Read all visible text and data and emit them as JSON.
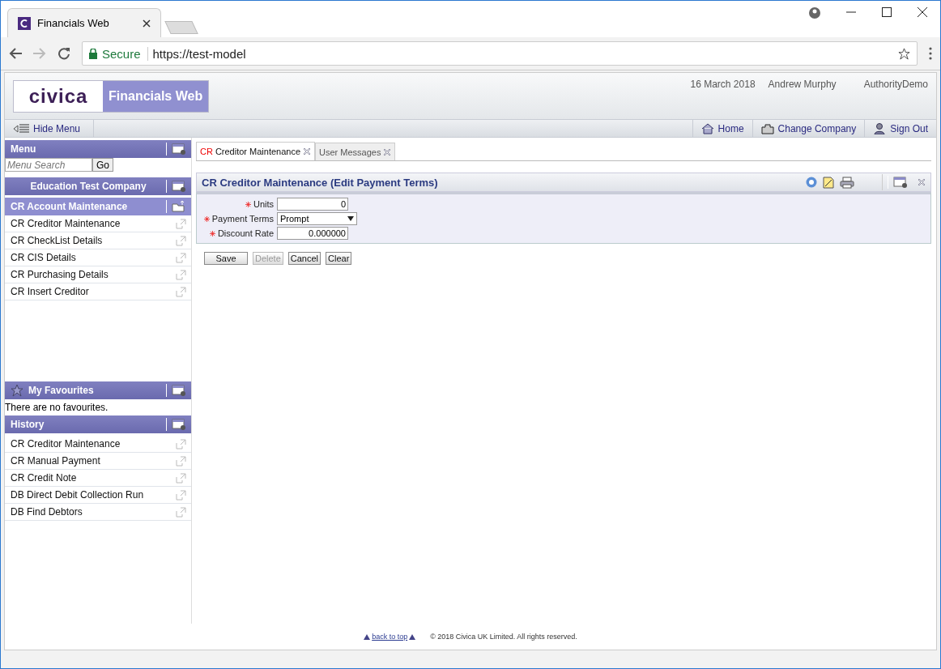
{
  "browser": {
    "tab_title": "Financials Web",
    "secure_label": "Secure",
    "url": "https://test-model"
  },
  "header": {
    "logo_text": "civica",
    "product": "Financials Web",
    "date": "16 March 2018",
    "user": "Andrew Murphy",
    "authority": "AuthorityDemo"
  },
  "navbar": {
    "hide_menu": "Hide Menu",
    "links": [
      {
        "kind": "home",
        "label": "Home"
      },
      {
        "kind": "company",
        "label": "Change Company"
      },
      {
        "kind": "signout",
        "label": "Sign Out"
      }
    ]
  },
  "sidebar": {
    "menu_title": "Menu",
    "search_placeholder": "Menu Search",
    "go": "Go",
    "company": "Education Test Company",
    "group": "CR Account Maintenance",
    "items": [
      "CR Creditor Maintenance",
      "CR CheckList Details",
      "CR CIS Details",
      "CR Purchasing Details",
      "CR Insert Creditor"
    ],
    "favourites_title": "My Favourites",
    "favourites_empty": "There are no favourites.",
    "history_title": "History",
    "history": [
      "CR Creditor Maintenance",
      "CR Manual Payment",
      "CR Credit Note",
      "DB Direct Debit Collection Run",
      "DB Find Debtors"
    ]
  },
  "tabs": [
    {
      "prefix": "CR",
      "label": "Creditor Maintenance",
      "selected": true
    },
    {
      "label": "User Messages",
      "selected": false
    }
  ],
  "panel": {
    "title": "CR Creditor Maintenance (Edit Payment Terms)",
    "fields": [
      {
        "kind": "number",
        "label": "Units",
        "value": "0",
        "required": true
      },
      {
        "kind": "select",
        "label": "Payment Terms",
        "value": "Prompt",
        "required": true
      },
      {
        "kind": "number",
        "label": "Discount Rate",
        "value": "0.000000",
        "required": true
      }
    ],
    "buttons": [
      {
        "label": "Save",
        "disabled": false
      },
      {
        "label": "Delete",
        "disabled": true
      },
      {
        "label": "Cancel",
        "disabled": false
      },
      {
        "label": "Clear",
        "disabled": false
      }
    ]
  },
  "footer": {
    "back_to_top": "back to top",
    "copyright": "© 2018 Civica UK Limited. All rights reserved."
  }
}
